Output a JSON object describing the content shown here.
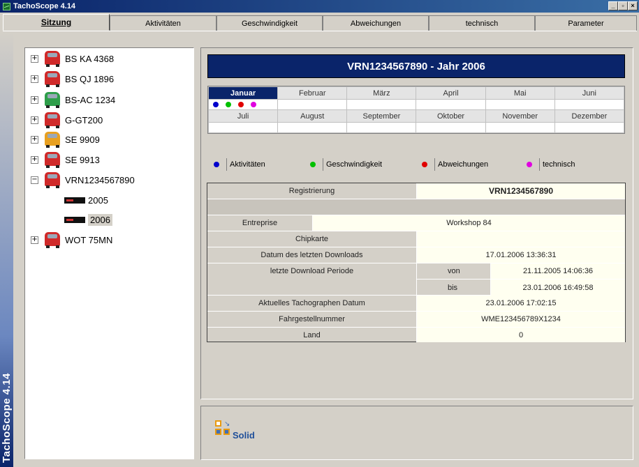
{
  "window": {
    "title": "TachoScope 4.14",
    "sidebar_caption": "TachoScope 4.14",
    "buttons": [
      "_",
      "▫",
      "×"
    ]
  },
  "tabs": [
    {
      "label": "Sitzung",
      "active": true
    },
    {
      "label": "Aktivitäten",
      "active": false
    },
    {
      "label": "Geschwindigkeit",
      "active": false
    },
    {
      "label": "Abweichungen",
      "active": false
    },
    {
      "label": "technisch",
      "active": false
    },
    {
      "label": "Parameter",
      "active": false
    }
  ],
  "tree": {
    "items": [
      {
        "label": "BS KA  4368",
        "truck_color": "#d02a2a"
      },
      {
        "label": "BS QJ 1896",
        "truck_color": "#d02a2a"
      },
      {
        "label": "BS-AC 1234",
        "truck_color": "#2e9e4a"
      },
      {
        "label": "G-GT200",
        "truck_color": "#d02a2a"
      },
      {
        "label": "SE 9909",
        "truck_color": "#e8a020"
      },
      {
        "label": "SE 9913",
        "truck_color": "#d02a2a"
      },
      {
        "label": "VRN1234567890",
        "truck_color": "#d02a2a"
      },
      {
        "label": "2005"
      },
      {
        "label": "2006"
      },
      {
        "label": "WOT 75MN",
        "truck_color": "#d02a2a"
      }
    ]
  },
  "header": {
    "title": "VRN1234567890  -  Jahr  2006"
  },
  "months": {
    "row1": [
      "Januar",
      "Februar",
      "März",
      "April",
      "Mai",
      "Juni"
    ],
    "row2": [
      "Juli",
      "August",
      "September",
      "Oktober",
      "November",
      "Dezember"
    ],
    "active": "Januar",
    "januar_dots": [
      "#0000cc",
      "#00c000",
      "#e00000",
      "#e000e0"
    ]
  },
  "legend": [
    {
      "label": "Aktivitäten",
      "color": "#0000cc"
    },
    {
      "label": "Geschwindigkeit",
      "color": "#00c000"
    },
    {
      "label": "Abweichungen",
      "color": "#e00000"
    },
    {
      "label": "technisch",
      "color": "#e000e0"
    }
  ],
  "info": {
    "registrierung_label": "Registrierung",
    "registrierung_value": "VRN1234567890",
    "entreprise_label": "Entreprise",
    "entreprise_value": "Workshop 84",
    "chipkarte_label": "Chipkarte",
    "chipkarte_value": "",
    "download_label": "Datum des letzten Downloads",
    "download_value": "17.01.2006 13:36:31",
    "period_label": "letzte Download Periode",
    "von_label": "von",
    "von_value": "21.11.2005 14:06:36",
    "bis_label": "bis",
    "bis_value": "23.01.2006 16:49:58",
    "tacho_date_label": "Aktuelles Tachographen Datum",
    "tacho_date_value": "23.01.2006 17:02:15",
    "fahrgestell_label": "Fahrgestellnummer",
    "fahrgestell_value": "WME123456789X1234",
    "land_label": "Land",
    "land_value": "0"
  },
  "logo": {
    "text": "Solid"
  }
}
